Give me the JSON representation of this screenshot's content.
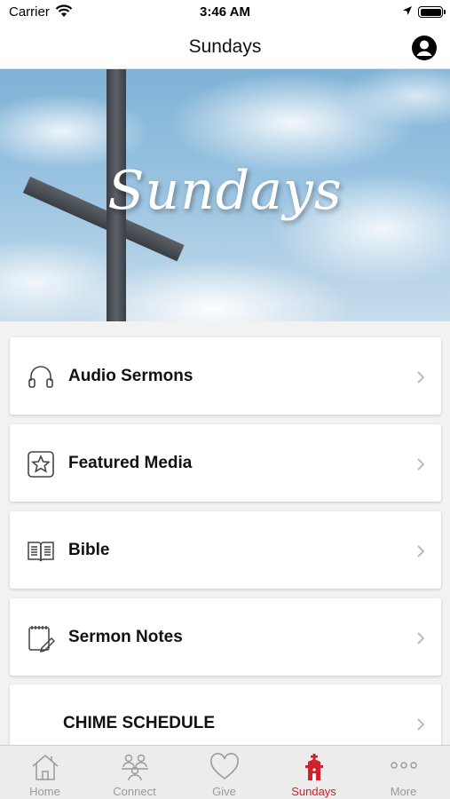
{
  "status": {
    "carrier": "Carrier",
    "time": "3:46 AM"
  },
  "nav": {
    "title": "Sundays"
  },
  "banner": {
    "text": "Sundays"
  },
  "menu": [
    {
      "label": "Audio Sermons",
      "icon": "headphones-icon"
    },
    {
      "label": "Featured Media",
      "icon": "star-icon"
    },
    {
      "label": "Bible",
      "icon": "book-icon"
    },
    {
      "label": "Sermon Notes",
      "icon": "notepad-icon"
    },
    {
      "label": "CHIME SCHEDULE",
      "icon": ""
    }
  ],
  "tabs": [
    {
      "label": "Home",
      "icon": "home-icon"
    },
    {
      "label": "Connect",
      "icon": "people-icon"
    },
    {
      "label": "Give",
      "icon": "heart-icon"
    },
    {
      "label": "Sundays",
      "icon": "church-icon",
      "active": true
    },
    {
      "label": "More",
      "icon": "more-icon"
    }
  ],
  "colors": {
    "accent": "#d0202a",
    "tab_inactive": "#9a9a9a"
  }
}
